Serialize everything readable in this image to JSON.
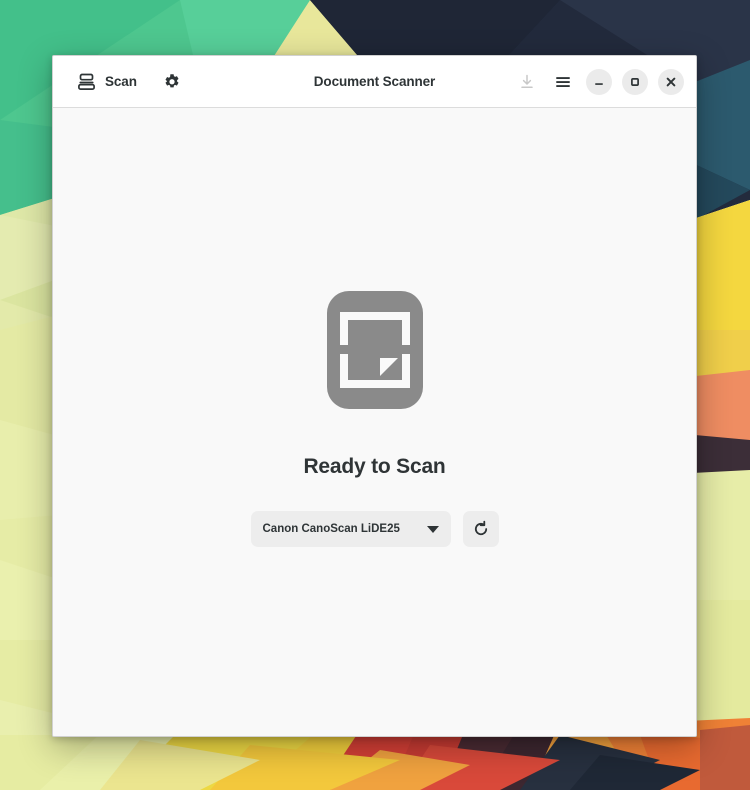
{
  "window": {
    "title": "Document Scanner"
  },
  "headerbar": {
    "scan_label": "Scan",
    "scan_icon": "scanner-icon",
    "preferences_icon": "gear-icon",
    "save_icon": "download-icon",
    "menu_icon": "hamburger-menu-icon",
    "minimize_icon": "minimize-icon",
    "maximize_icon": "maximize-icon",
    "close_icon": "close-icon"
  },
  "main": {
    "placeholder_icon": "document-scanner-page-icon",
    "status_text": "Ready to Scan",
    "device": {
      "selected": "Canon CanoScan LiDE25",
      "dropdown_icon": "chevron-down-icon",
      "refresh_icon": "refresh-icon"
    }
  },
  "colors": {
    "headerbar_bg": "#ffffff",
    "content_bg": "#f9f9f9",
    "text": "#2e3436",
    "placeholder_icon": "#8a8a8a",
    "control_bg": "#ededed",
    "window_control_bg": "#ebebeb",
    "disabled_icon": "#c8c8c8"
  }
}
